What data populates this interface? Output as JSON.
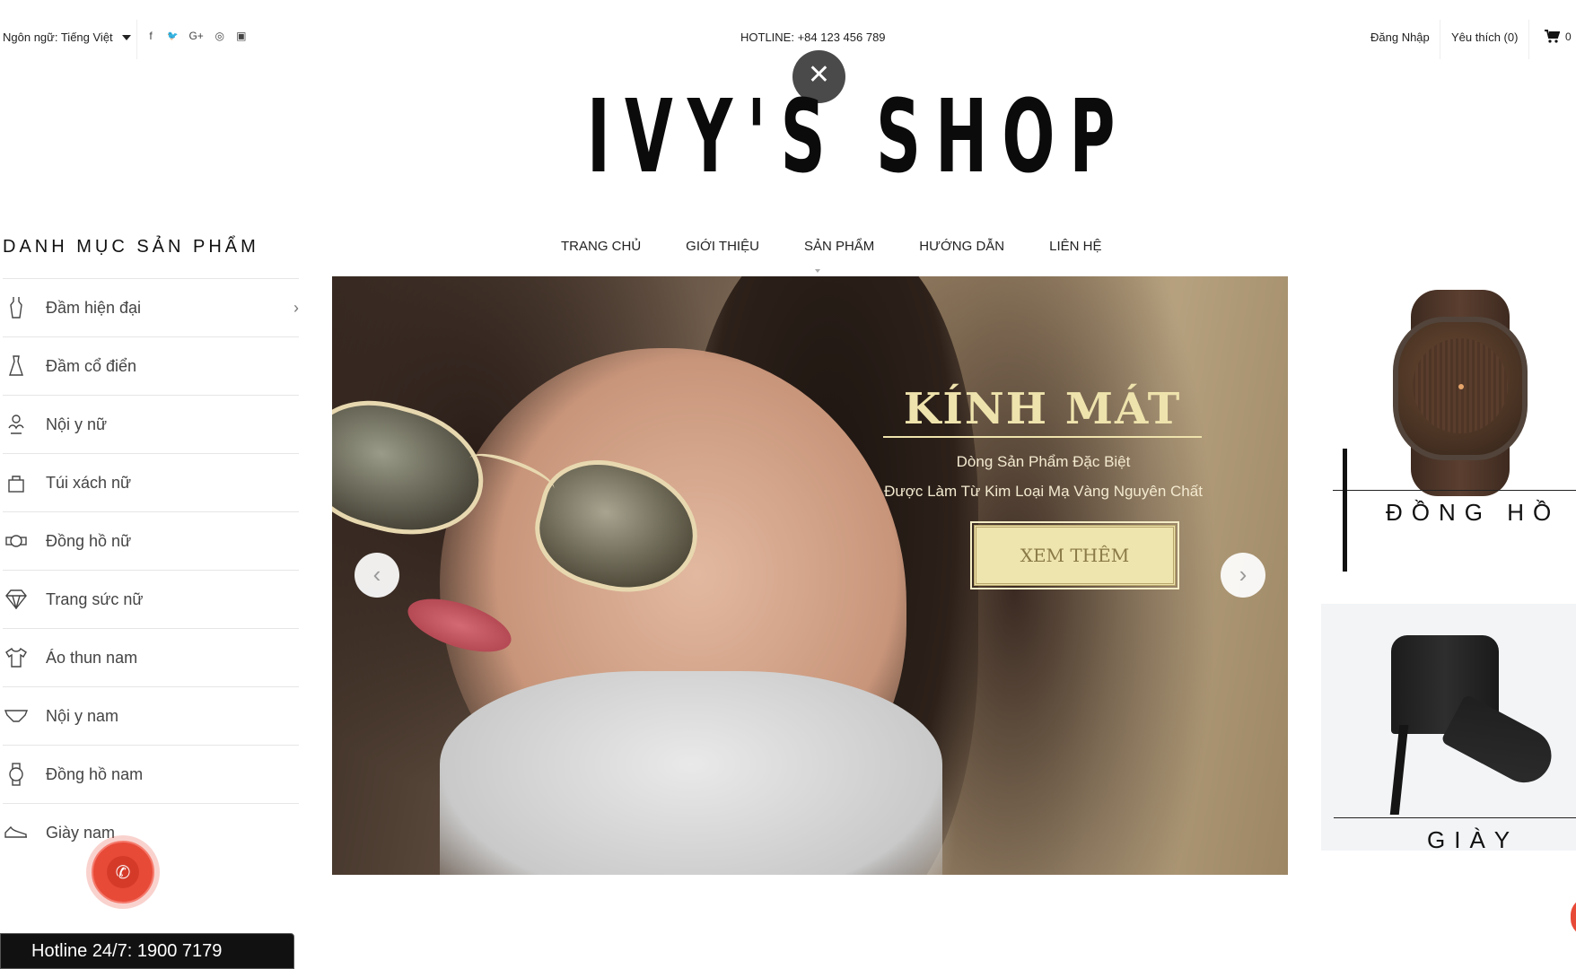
{
  "topbar": {
    "language_label": "Ngôn ngữ: Tiếng Việt",
    "social_icons": [
      "facebook-icon",
      "twitter-icon",
      "google-plus-icon",
      "instagram-icon",
      "youtube-icon"
    ],
    "social_glyphs": [
      "f",
      "🐦",
      "G+",
      "◎",
      "▣"
    ],
    "hotline": "HOTLINE: +84 123 456 789",
    "login": "Đăng Nhập",
    "wishlist": "Yêu thích (0)",
    "cart_count": "0"
  },
  "close_button": "✕",
  "logo": "IVY'S SHOP",
  "sidebar": {
    "title": "DANH MỤC SẢN PHẨM",
    "items": [
      {
        "label": "Đầm hiện đại",
        "icon": "dress-icon",
        "has_submenu": true
      },
      {
        "label": "Đầm cổ điển",
        "icon": "vintage-dress-icon"
      },
      {
        "label": "Nội y nữ",
        "icon": "bra-icon"
      },
      {
        "label": "Túi xách nữ",
        "icon": "handbag-icon"
      },
      {
        "label": "Đồng hồ nữ",
        "icon": "women-watch-icon"
      },
      {
        "label": "Trang sức nữ",
        "icon": "diamond-icon"
      },
      {
        "label": "Áo thun nam",
        "icon": "tshirt-icon"
      },
      {
        "label": "Nội y nam",
        "icon": "underwear-icon"
      },
      {
        "label": "Đồng hồ nam",
        "icon": "men-watch-icon"
      },
      {
        "label": "Giày nam",
        "icon": "sneaker-icon"
      }
    ],
    "chevron": "›"
  },
  "nav": {
    "items": [
      "TRANG CHỦ",
      "GIỚI THIỆU",
      "SẢN PHẨM",
      "HƯỚNG DẪN",
      "LIÊN HỆ"
    ]
  },
  "hero": {
    "title": "KÍNH MÁT",
    "subtitle_1": "Dòng Sản Phẩm Đặc Biệt",
    "subtitle_2": "Được Làm Từ Kim Loại Mạ Vàng Nguyên Chất",
    "button": "XEM THÊM",
    "prev": "‹",
    "next": "›"
  },
  "promos": {
    "watch_label": "ĐỒNG HỒ",
    "shoe_label": "GIÀY"
  },
  "floating": {
    "phone_glyph": "✆",
    "hotline_bar": "Hotline 24/7: 1900 7179"
  }
}
